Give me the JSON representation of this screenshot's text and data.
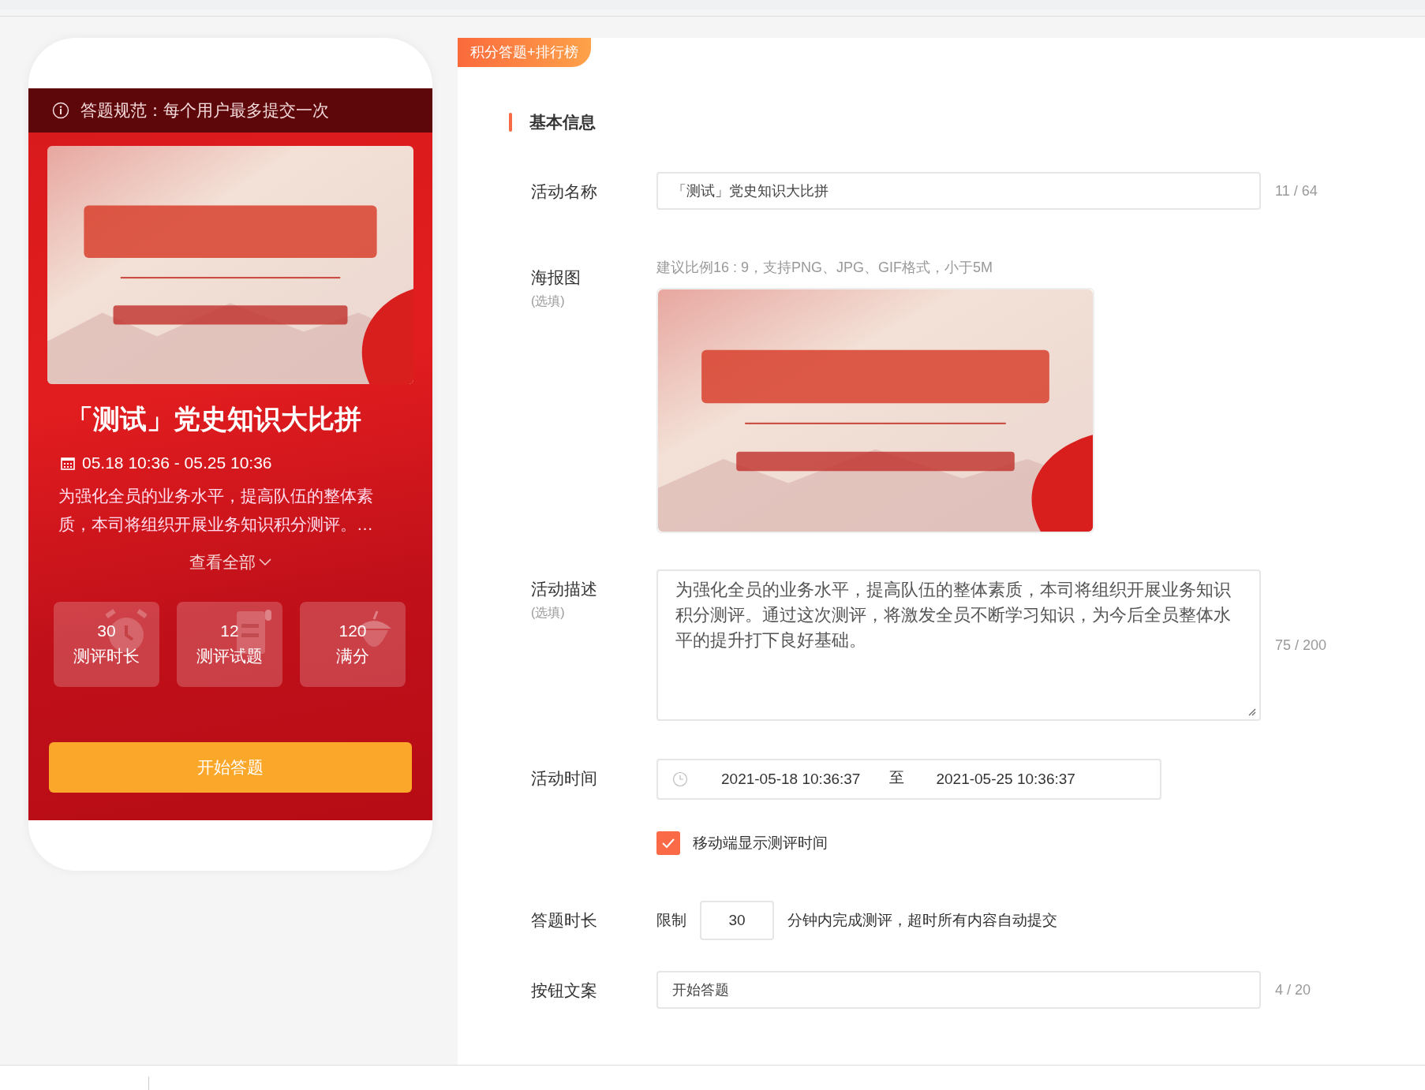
{
  "preview": {
    "notice": "答题规范：每个用户最多提交一次",
    "title": "「测试」党史知识大比拼",
    "date_range": "05.18 10:36 - 05.25 10:36",
    "description": "为强化全员的业务水平，提高队伍的整体素质，本司将组织开展业务知识积分测评。…",
    "expand_link": "查看全部",
    "stats": [
      {
        "kind": "clock",
        "value": "30",
        "label": "测评时长"
      },
      {
        "kind": "paper",
        "value": "12",
        "label": "测评试题"
      },
      {
        "kind": "acorn",
        "value": "120",
        "label": "满分"
      }
    ],
    "start_button": "开始答题"
  },
  "form": {
    "tab": "积分答题+排行榜",
    "section_title": "基本信息",
    "fields": [
      {
        "kind": "text",
        "label": "活动名称",
        "value": "「测试」党史知识大比拼",
        "counter": "11 / 64"
      },
      {
        "kind": "image",
        "label": "海报图",
        "optional": "(选填)",
        "hint": "建议比例16 : 9，支持PNG、JPG、GIF格式，小于5M"
      },
      {
        "kind": "textarea",
        "label": "活动描述",
        "optional": "(选填)",
        "value": "为强化全员的业务水平，提高队伍的整体素质，本司将组织开展业务知识积分测评。通过这次测评，将激发全员不断学习知识，为今后全员整体水平的提升打下良好基础。",
        "counter": "75 / 200"
      },
      {
        "kind": "daterange",
        "label": "活动时间",
        "start": "2021-05-18 10:36:37",
        "separator": "至",
        "end": "2021-05-25 10:36:37"
      },
      {
        "kind": "checkbox",
        "text": "移动端显示测评时间",
        "checked": true
      },
      {
        "kind": "duration",
        "label": "答题时长",
        "prefix": "限制",
        "value": "30",
        "suffix": "分钟内完成测评，超时所有内容自动提交"
      },
      {
        "kind": "text",
        "label": "按钮文案",
        "value": "开始答题",
        "counter": "4 / 20"
      }
    ]
  }
}
